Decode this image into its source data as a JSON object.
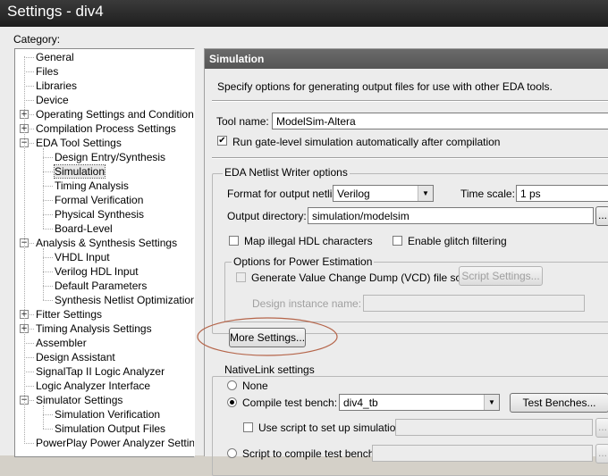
{
  "window": {
    "title": "Settings - div4"
  },
  "category_label": "Category:",
  "tree": [
    {
      "label": "General",
      "level": 0,
      "expander": ""
    },
    {
      "label": "Files",
      "level": 0,
      "expander": ""
    },
    {
      "label": "Libraries",
      "level": 0,
      "expander": ""
    },
    {
      "label": "Device",
      "level": 0,
      "expander": ""
    },
    {
      "label": "Operating Settings and Conditions",
      "level": 0,
      "expander": "+"
    },
    {
      "label": "Compilation Process Settings",
      "level": 0,
      "expander": "+"
    },
    {
      "label": "EDA Tool Settings",
      "level": 0,
      "expander": "-"
    },
    {
      "label": "Design Entry/Synthesis",
      "level": 1,
      "expander": ""
    },
    {
      "label": "Simulation",
      "level": 1,
      "expander": "",
      "selected": true
    },
    {
      "label": "Timing Analysis",
      "level": 1,
      "expander": ""
    },
    {
      "label": "Formal Verification",
      "level": 1,
      "expander": ""
    },
    {
      "label": "Physical Synthesis",
      "level": 1,
      "expander": ""
    },
    {
      "label": "Board-Level",
      "level": 1,
      "expander": ""
    },
    {
      "label": "Analysis & Synthesis Settings",
      "level": 0,
      "expander": "-"
    },
    {
      "label": "VHDL Input",
      "level": 1,
      "expander": ""
    },
    {
      "label": "Verilog HDL Input",
      "level": 1,
      "expander": ""
    },
    {
      "label": "Default Parameters",
      "level": 1,
      "expander": ""
    },
    {
      "label": "Synthesis Netlist Optimizations",
      "level": 1,
      "expander": ""
    },
    {
      "label": "Fitter Settings",
      "level": 0,
      "expander": "+"
    },
    {
      "label": "Timing Analysis Settings",
      "level": 0,
      "expander": "+"
    },
    {
      "label": "Assembler",
      "level": 0,
      "expander": ""
    },
    {
      "label": "Design Assistant",
      "level": 0,
      "expander": ""
    },
    {
      "label": "SignalTap II Logic Analyzer",
      "level": 0,
      "expander": ""
    },
    {
      "label": "Logic Analyzer Interface",
      "level": 0,
      "expander": ""
    },
    {
      "label": "Simulator Settings",
      "level": 0,
      "expander": "-"
    },
    {
      "label": "Simulation Verification",
      "level": 1,
      "expander": ""
    },
    {
      "label": "Simulation Output Files",
      "level": 1,
      "expander": ""
    },
    {
      "label": "PowerPlay Power Analyzer Settings",
      "level": 0,
      "expander": ""
    }
  ],
  "panel": {
    "header": "Simulation",
    "description": "Specify options for generating output files for use with other EDA tools.",
    "tool_name_label": "Tool name:",
    "tool_name_value": "ModelSim-Altera",
    "run_gate_level_label": "Run gate-level simulation automatically after compilation",
    "run_gate_level_checked": true,
    "netlist_group_title": "EDA Netlist Writer options",
    "format_label": "Format for output netlist:",
    "format_value": "Verilog",
    "timescale_label": "Time scale:",
    "timescale_value": "1 ps",
    "output_dir_label": "Output directory:",
    "output_dir_value": "simulation/modelsim",
    "browse_label": "...",
    "map_illegal_label": "Map illegal HDL characters",
    "enable_glitch_label": "Enable glitch filtering",
    "power_group_title": "Options for Power Estimation",
    "vcd_label": "Generate Value Change Dump (VCD) file script",
    "script_settings_label": "Script Settings...",
    "design_instance_label": "Design instance name:",
    "more_settings_label": "More Settings...",
    "nativelink_title": "NativeLink settings",
    "none_label": "None",
    "compile_tb_label": "Compile test bench:",
    "compile_tb_value": "div4_tb",
    "test_benches_label": "Test Benches...",
    "use_script_label": "Use script to set up simulation:",
    "script_compile_label": "Script to compile test bench:"
  },
  "colors": {
    "highlight_ellipse": "#b5654a",
    "header_bg": "#5f5f5f"
  }
}
